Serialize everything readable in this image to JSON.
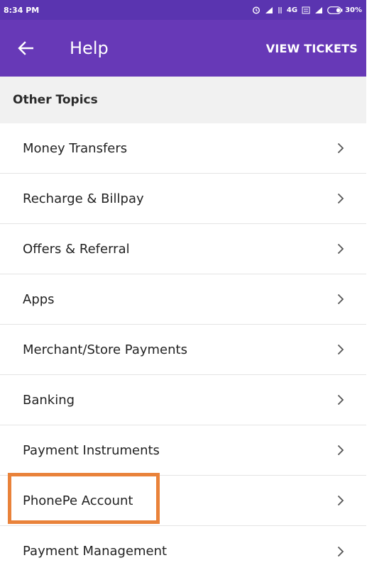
{
  "status_bar": {
    "time": "8:34 PM",
    "network": "4G",
    "battery": "30%",
    "icons": [
      "alarm-icon",
      "signal-icon",
      "data-arrows-icon",
      "lte-icon",
      "signal-icon",
      "battery-icon"
    ]
  },
  "app_bar": {
    "back_icon": "arrow-left-icon",
    "title": "Help",
    "action_label": "VIEW TICKETS"
  },
  "section": {
    "header": "Other Topics"
  },
  "topics": [
    {
      "label": "Money Transfers"
    },
    {
      "label": "Recharge & Billpay"
    },
    {
      "label": "Offers & Referral"
    },
    {
      "label": "Apps"
    },
    {
      "label": "Merchant/Store Payments"
    },
    {
      "label": "Banking"
    },
    {
      "label": "Payment Instruments"
    },
    {
      "label": "PhonePe Account"
    },
    {
      "label": "Payment Management"
    }
  ],
  "colors": {
    "status_bar": "#5a34b0",
    "app_bar": "#6739b7",
    "highlight": "#e9823a",
    "section_bg": "#f1f1f1"
  }
}
